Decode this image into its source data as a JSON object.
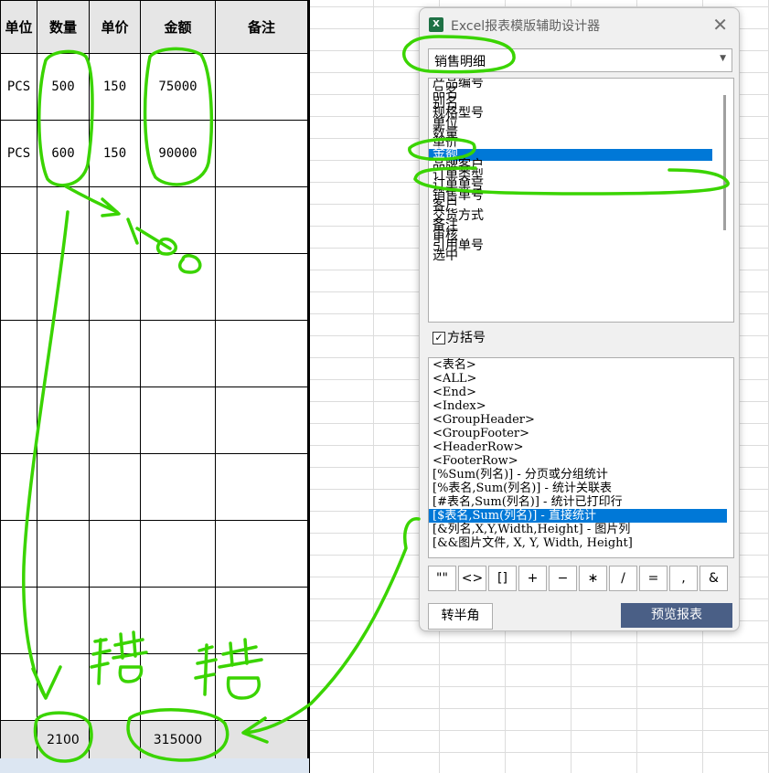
{
  "table": {
    "headers": [
      "单位",
      "数量",
      "单价",
      "金额",
      "备注"
    ],
    "rows": [
      [
        "PCS",
        "500",
        "150",
        "75000",
        ""
      ],
      [
        "PCS",
        "600",
        "150",
        "90000",
        ""
      ],
      [
        "",
        "",
        "",
        "",
        ""
      ],
      [
        "",
        "",
        "",
        "",
        ""
      ],
      [
        "",
        "",
        "",
        "",
        ""
      ],
      [
        "",
        "",
        "",
        "",
        ""
      ],
      [
        "",
        "",
        "",
        "",
        ""
      ],
      [
        "",
        "",
        "",
        "",
        ""
      ],
      [
        "",
        "",
        "",
        "",
        ""
      ],
      [
        "",
        "",
        "",
        "",
        ""
      ]
    ],
    "totals": [
      "",
      "2100",
      "",
      "315000",
      ""
    ]
  },
  "dialog": {
    "title": "Excel报表模版辅助设计器",
    "close": "✕",
    "table_select": "销售明细",
    "fields": [
      "产品编号",
      "品名",
      "别名",
      "规格型号",
      "单位",
      "数量",
      "单价",
      "金额",
      "品牌客户",
      "订单类型",
      "订单单号",
      "销售单号",
      "客户",
      "交货方式",
      "备注",
      "审核",
      "引用单号",
      "选中"
    ],
    "selected_field": "金额",
    "bracket_checkbox_label": "方括号",
    "bracket_checked": true,
    "tags": [
      "<表名>",
      "<ALL>",
      "<End>",
      "<Index>",
      "<GroupHeader>",
      "<GroupFooter>",
      "<HeaderRow>",
      "<FooterRow>",
      "[%Sum(列名)] - 分页或分组统计",
      "[%表名,Sum(列名)] - 统计关联表",
      "[#表名,Sum(列名)] - 统计已打印行",
      "[$表名,Sum(列名)] - 直接统计",
      "[&列名,X,Y,Width,Height] - 图片列",
      "[&&图片文件, X, Y, Width, Height]"
    ],
    "selected_tag": "[$表名,Sum(列名)] - 直接统计",
    "symbols": [
      "\"\"",
      "<>",
      "[]",
      "+",
      "−",
      "∗",
      "/",
      "=",
      ",",
      "&"
    ],
    "btn_half": "转半角",
    "btn_preview": "预览报表"
  },
  "annotations": {
    "note_1100": "1100",
    "note_wrong": "错",
    "stroke_color": "#3ad400"
  }
}
